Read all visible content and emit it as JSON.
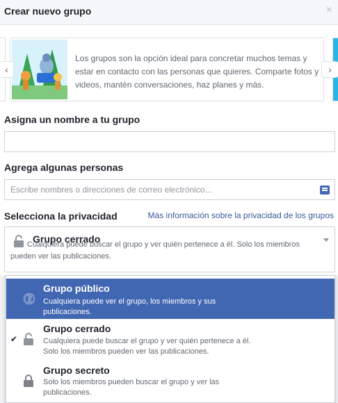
{
  "dialog": {
    "title": "Crear nuevo grupo",
    "close_label": "×"
  },
  "carousel": {
    "prev_label": "‹",
    "next_label": "›",
    "text": "Los grupos son la opción ideal para concretar muchos temas y estar en contacto con las personas que quieres. Comparte fotos y videos, mantén conversaciones, haz planes y más."
  },
  "name_section": {
    "label": "Asigna un nombre a tu grupo",
    "value": "",
    "placeholder": ""
  },
  "people_section": {
    "label": "Agrega algunas personas",
    "placeholder": "Escribe nombres o direcciones de correo electrónico..."
  },
  "privacy": {
    "label": "Selecciona la privacidad",
    "more_info_link": "Más información sobre la privacidad de los grupos",
    "selected": {
      "title": "Grupo cerrado",
      "description": "Cualquiera puede buscar el grupo y ver quién pertenece a él. Solo los miembros pueden ver las publicaciones."
    },
    "options": [
      {
        "title": "Grupo público",
        "description": "Cualquiera puede ver el grupo, los miembros y sus publicaciones.",
        "icon": "globe-icon",
        "highlighted": true,
        "checked": false
      },
      {
        "title": "Grupo cerrado",
        "description": "Cualquiera puede buscar el grupo y ver quién pertenece a él. Solo los miembros pueden ver las publicaciones.",
        "icon": "lock-icon",
        "highlighted": false,
        "checked": true
      },
      {
        "title": "Grupo secreto",
        "description": "Solo los miembros pueden buscar el grupo y ver las publicaciones.",
        "icon": "lock-icon",
        "highlighted": false,
        "checked": false
      }
    ],
    "check_mark": "✔"
  },
  "colors": {
    "accent": "#4267b2",
    "link": "#365899",
    "text_primary": "#1d2129",
    "text_secondary": "#606770"
  }
}
